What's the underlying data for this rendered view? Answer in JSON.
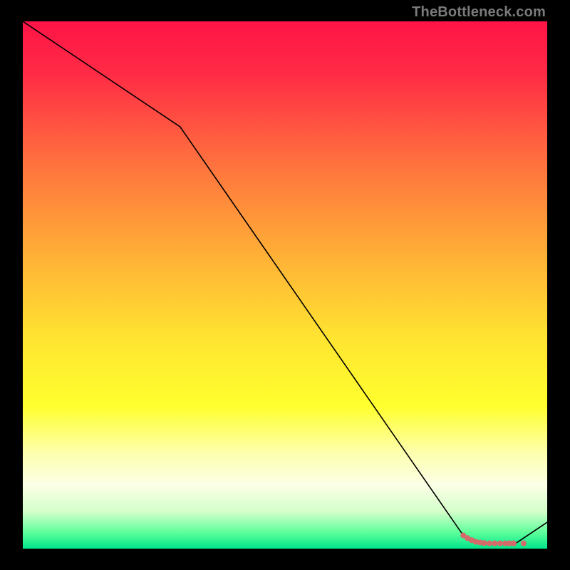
{
  "attribution": "TheBottleneck.com",
  "gradient_stops": [
    {
      "offset": 0.0,
      "color": "#ff1447"
    },
    {
      "offset": 0.1,
      "color": "#ff2b45"
    },
    {
      "offset": 0.25,
      "color": "#ff6a3f"
    },
    {
      "offset": 0.45,
      "color": "#ffb236"
    },
    {
      "offset": 0.6,
      "color": "#ffe431"
    },
    {
      "offset": 0.73,
      "color": "#ffff2e"
    },
    {
      "offset": 0.82,
      "color": "#fdffb0"
    },
    {
      "offset": 0.88,
      "color": "#fbffe6"
    },
    {
      "offset": 0.93,
      "color": "#d4ffca"
    },
    {
      "offset": 0.97,
      "color": "#5cff9a"
    },
    {
      "offset": 1.0,
      "color": "#00e58a"
    }
  ],
  "dot_color": "#d46a6a",
  "chart_data": {
    "type": "line",
    "title": "",
    "xlabel": "",
    "ylabel": "",
    "xlim": [
      0,
      100
    ],
    "ylim": [
      0,
      100
    ],
    "series": [
      {
        "name": "curve",
        "x": [
          0,
          30,
          84,
          88,
          94,
          100
        ],
        "y": [
          100,
          80,
          2.5,
          1,
          1,
          5
        ],
        "stroke": "#000000",
        "stroke_width": 1.6
      }
    ],
    "markers": [
      {
        "x": 84.0,
        "y": 2.5
      },
      {
        "x": 84.8,
        "y": 2.0
      },
      {
        "x": 85.6,
        "y": 1.6
      },
      {
        "x": 86.4,
        "y": 1.3
      },
      {
        "x": 87.2,
        "y": 1.15
      },
      {
        "x": 88.0,
        "y": 1.05
      },
      {
        "x": 89.0,
        "y": 1.0
      },
      {
        "x": 90.0,
        "y": 1.0
      },
      {
        "x": 91.0,
        "y": 1.0
      },
      {
        "x": 92.0,
        "y": 1.0
      },
      {
        "x": 92.8,
        "y": 1.0
      },
      {
        "x": 93.6,
        "y": 1.0
      },
      {
        "x": 95.5,
        "y": 1.0
      }
    ]
  }
}
